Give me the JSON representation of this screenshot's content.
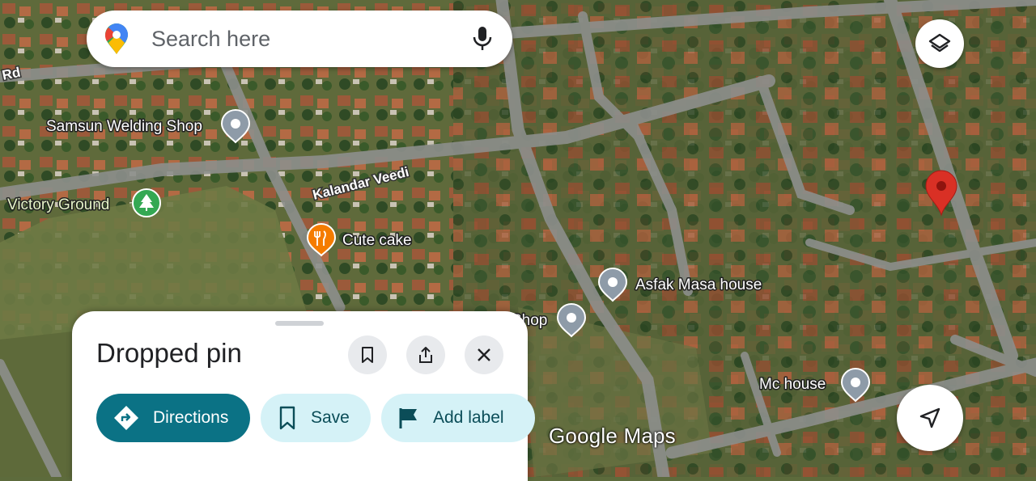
{
  "search": {
    "placeholder": "Search here",
    "google_pin_icon": "google-maps-pin-icon",
    "mic_icon": "microphone-icon"
  },
  "map": {
    "road_labels": {
      "rd": "Rd",
      "kalandar": "Kalandar Veedi"
    },
    "places": {
      "samsun": "Samsun Welding Shop",
      "victory": "Victory Ground",
      "cake": "Cute cake",
      "asfak": "Asfak Masa house",
      "shop": "Shop",
      "mc": "Mc house"
    },
    "colors": {
      "pin_gray": "#8e9ba8",
      "pin_red": "#d93025",
      "food_orange": "#f57c00",
      "park_green": "#34a853"
    }
  },
  "watermark": "Google Maps",
  "controls": {
    "layers_icon": "layers-icon",
    "navigation_icon": "navigation-arrow-icon"
  },
  "sheet": {
    "title": "Dropped pin",
    "actions": {
      "save_icon": "bookmark-icon",
      "share_icon": "share-icon",
      "close_icon": "close-icon"
    },
    "chips": {
      "directions": "Directions",
      "save": "Save",
      "add_label": "Add label"
    },
    "accent": "#0b7285"
  }
}
